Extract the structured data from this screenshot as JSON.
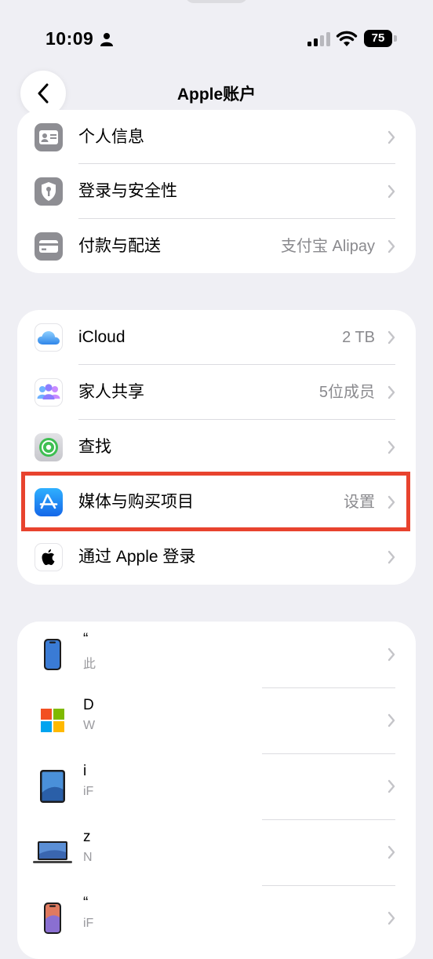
{
  "status_bar": {
    "time": "10:09",
    "battery": "75"
  },
  "nav": {
    "title": "Apple账户"
  },
  "group1": [
    {
      "label": "个人信息",
      "value": ""
    },
    {
      "label": "登录与安全性",
      "value": ""
    },
    {
      "label": "付款与配送",
      "value": "支付宝 Alipay"
    }
  ],
  "group2": [
    {
      "label": "iCloud",
      "value": "2 TB"
    },
    {
      "label": "家人共享",
      "value": "5位成员"
    },
    {
      "label": "查找",
      "value": ""
    },
    {
      "label": "媒体与购买项目",
      "value": "设置"
    },
    {
      "label": "通过 Apple 登录",
      "value": ""
    }
  ],
  "devices": [
    {
      "name": "“",
      "sub": "此"
    },
    {
      "name": "D",
      "sub": "W"
    },
    {
      "name": "i",
      "sub": "iF"
    },
    {
      "name": "z",
      "sub": "N"
    },
    {
      "name": "“",
      "sub": "iF"
    }
  ]
}
